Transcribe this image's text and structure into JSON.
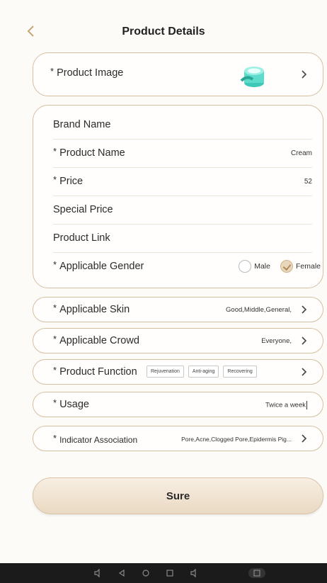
{
  "header": {
    "title": "Product Details",
    "back_icon": "chevron-left-icon"
  },
  "product_image": {
    "label": "Product Image",
    "required": "*"
  },
  "form": {
    "brand_name": {
      "label": "Brand Name",
      "value": ""
    },
    "product_name": {
      "label": "Product Name",
      "required": "*",
      "value": "Cream"
    },
    "price": {
      "label": "Price",
      "required": "*",
      "value": "52"
    },
    "special_price": {
      "label": "Special Price",
      "value": ""
    },
    "product_link": {
      "label": "Product Link",
      "value": ""
    },
    "gender": {
      "label": "Applicable Gender",
      "required": "*",
      "options": [
        "Male",
        "Female"
      ],
      "selected": "Female"
    }
  },
  "skin": {
    "label": "Applicable Skin",
    "required": "*",
    "value": "Good,Middle,General,"
  },
  "crowd": {
    "label": "Applicable Crowd",
    "required": "*",
    "value": "Everyone,"
  },
  "function": {
    "label": "Product Function",
    "required": "*",
    "chips": [
      "Rejuvenation",
      "Anti-aging",
      "Recovering"
    ]
  },
  "usage": {
    "label": "Usage",
    "required": "*",
    "value": "Twice a week"
  },
  "indicator": {
    "label": "Indicator Association",
    "required": "*",
    "value": "Pore,Acne,Clogged Pore,Epidermis Pig..."
  },
  "submit_label": "Sure",
  "colors": {
    "accent": "#c9a57a",
    "border": "#d6bfa0",
    "background": "#fcfbf8"
  }
}
